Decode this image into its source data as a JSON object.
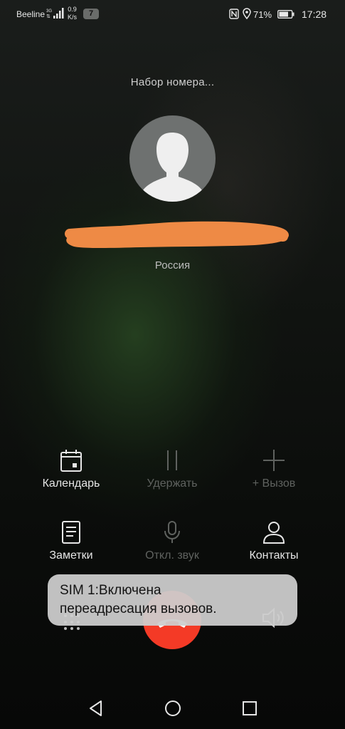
{
  "status_bar": {
    "carrier": "Beeline",
    "network_type": "3G",
    "speed_value": "0.9",
    "speed_unit": "K/s",
    "notification_count": "7",
    "battery_percent": "71%",
    "time": "17:28",
    "icons": [
      "signal-icon",
      "nfc-icon",
      "location-icon",
      "battery-icon"
    ]
  },
  "call": {
    "status": "Набор номера...",
    "country": "Россия"
  },
  "actions": [
    {
      "label": "Календарь",
      "icon": "calendar-icon",
      "enabled": true
    },
    {
      "label": "Удержать",
      "icon": "pause-icon",
      "enabled": false
    },
    {
      "label": "+ Вызов",
      "icon": "plus-icon",
      "enabled": false
    },
    {
      "label": "Заметки",
      "icon": "notes-icon",
      "enabled": true
    },
    {
      "label": "Откл. звук",
      "icon": "microphone-icon",
      "enabled": false
    },
    {
      "label": "Контакты",
      "icon": "contacts-icon",
      "enabled": true
    }
  ],
  "toast": {
    "line1": "SIM 1:Включена",
    "line2": "переадресация вызовов."
  },
  "colors": {
    "end_call": "#f43a26",
    "redaction": "#ee8a45",
    "enabled_text": "#e6e6e6",
    "disabled_text": "#5f625f"
  }
}
